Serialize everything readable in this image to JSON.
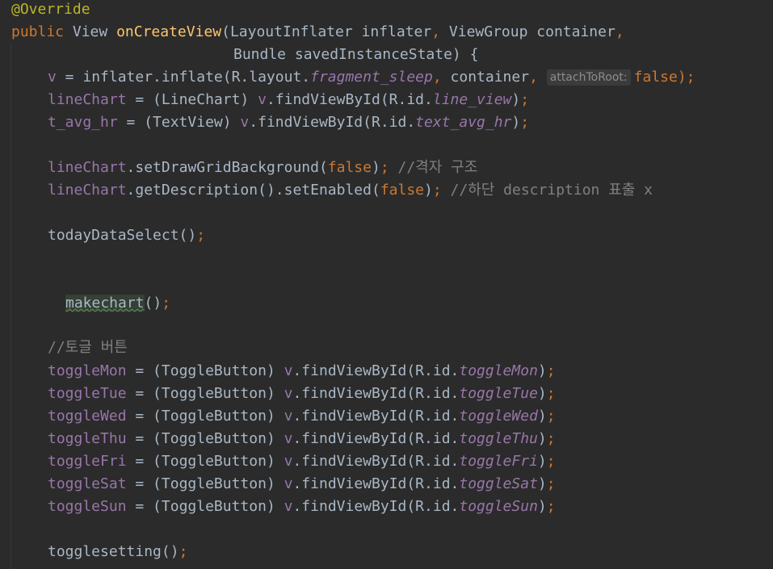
{
  "colors": {
    "background": "#2b2b2b",
    "default_text": "#a9b7c6",
    "keyword": "#cc7832",
    "method_decl": "#ffc66d",
    "field": "#9876aa",
    "comment": "#808080",
    "annotation": "#bbb529",
    "hint_background": "#3b3b3b",
    "highlight_background": "#344134"
  },
  "code": {
    "l1": {
      "annotation": "@Override"
    },
    "l2": {
      "kw": "public",
      "type": "View",
      "method": "onCreateView",
      "params": "(LayoutInflater inflater",
      "comma": ",",
      "params2": " ViewGroup container",
      "comma2": ","
    },
    "l3": {
      "params": "Bundle savedInstanceState) {"
    },
    "l4": {
      "var": "v",
      "eq": " = inflater.inflate(R.layout.",
      "res": "fragment_sleep",
      "comma": ",",
      "arg": " container",
      "comma2": ",",
      "hint": "attachToRoot:",
      "val": "false",
      "end": ");"
    },
    "l5": {
      "var": "lineChart",
      "eq": " = (LineChart) ",
      "v": "v",
      "call": ".findViewById(R.id.",
      "res": "line_view",
      "close": ")",
      "semi": ";"
    },
    "l6": {
      "var": "t_avg_hr",
      "eq": " = (TextView) ",
      "v": "v",
      "call": ".findViewById(R.id.",
      "res": "text_avg_hr",
      "close": ")",
      "semi": ";"
    },
    "l7": {
      "var": "lineChart",
      "call": ".setDrawGridBackground(",
      "val": "false",
      "close": ")",
      "semi": ";",
      "comment": " //격자 구조"
    },
    "l8": {
      "var": "lineChart",
      "call": ".getDescription().setEnabled(",
      "val": "false",
      "close": ")",
      "semi": ";",
      "comment": " //하단 description 표출 x"
    },
    "l9": {
      "call": "todayDataSelect()",
      "semi": ";"
    },
    "l10": {
      "call": "makechart",
      "rest": "()",
      "semi": ";"
    },
    "l11": {
      "comment": "//토글 버튼"
    },
    "toggles": [
      {
        "var": "toggleMon",
        "eq": " = (ToggleButton) ",
        "v": "v",
        "call": ".findViewById(R.id.",
        "res": "toggleMon",
        "close": ")",
        "semi": ";"
      },
      {
        "var": "toggleTue",
        "eq": " = (ToggleButton) ",
        "v": "v",
        "call": ".findViewById(R.id.",
        "res": "toggleTue",
        "close": ")",
        "semi": ";"
      },
      {
        "var": "toggleWed",
        "eq": " = (ToggleButton) ",
        "v": "v",
        "call": ".findViewById(R.id.",
        "res": "toggleWed",
        "close": ")",
        "semi": ";"
      },
      {
        "var": "toggleThu",
        "eq": " = (ToggleButton) ",
        "v": "v",
        "call": ".findViewById(R.id.",
        "res": "toggleThu",
        "close": ")",
        "semi": ";"
      },
      {
        "var": "toggleFri",
        "eq": " = (ToggleButton) ",
        "v": "v",
        "call": ".findViewById(R.id.",
        "res": "toggleFri",
        "close": ")",
        "semi": ";"
      },
      {
        "var": "toggleSat",
        "eq": " = (ToggleButton) ",
        "v": "v",
        "call": ".findViewById(R.id.",
        "res": "toggleSat",
        "close": ")",
        "semi": ";"
      },
      {
        "var": "toggleSun",
        "eq": " = (ToggleButton) ",
        "v": "v",
        "call": ".findViewById(R.id.",
        "res": "toggleSun",
        "close": ")",
        "semi": ";"
      }
    ],
    "l19": {
      "call": "togglesetting()",
      "semi": ";"
    }
  }
}
